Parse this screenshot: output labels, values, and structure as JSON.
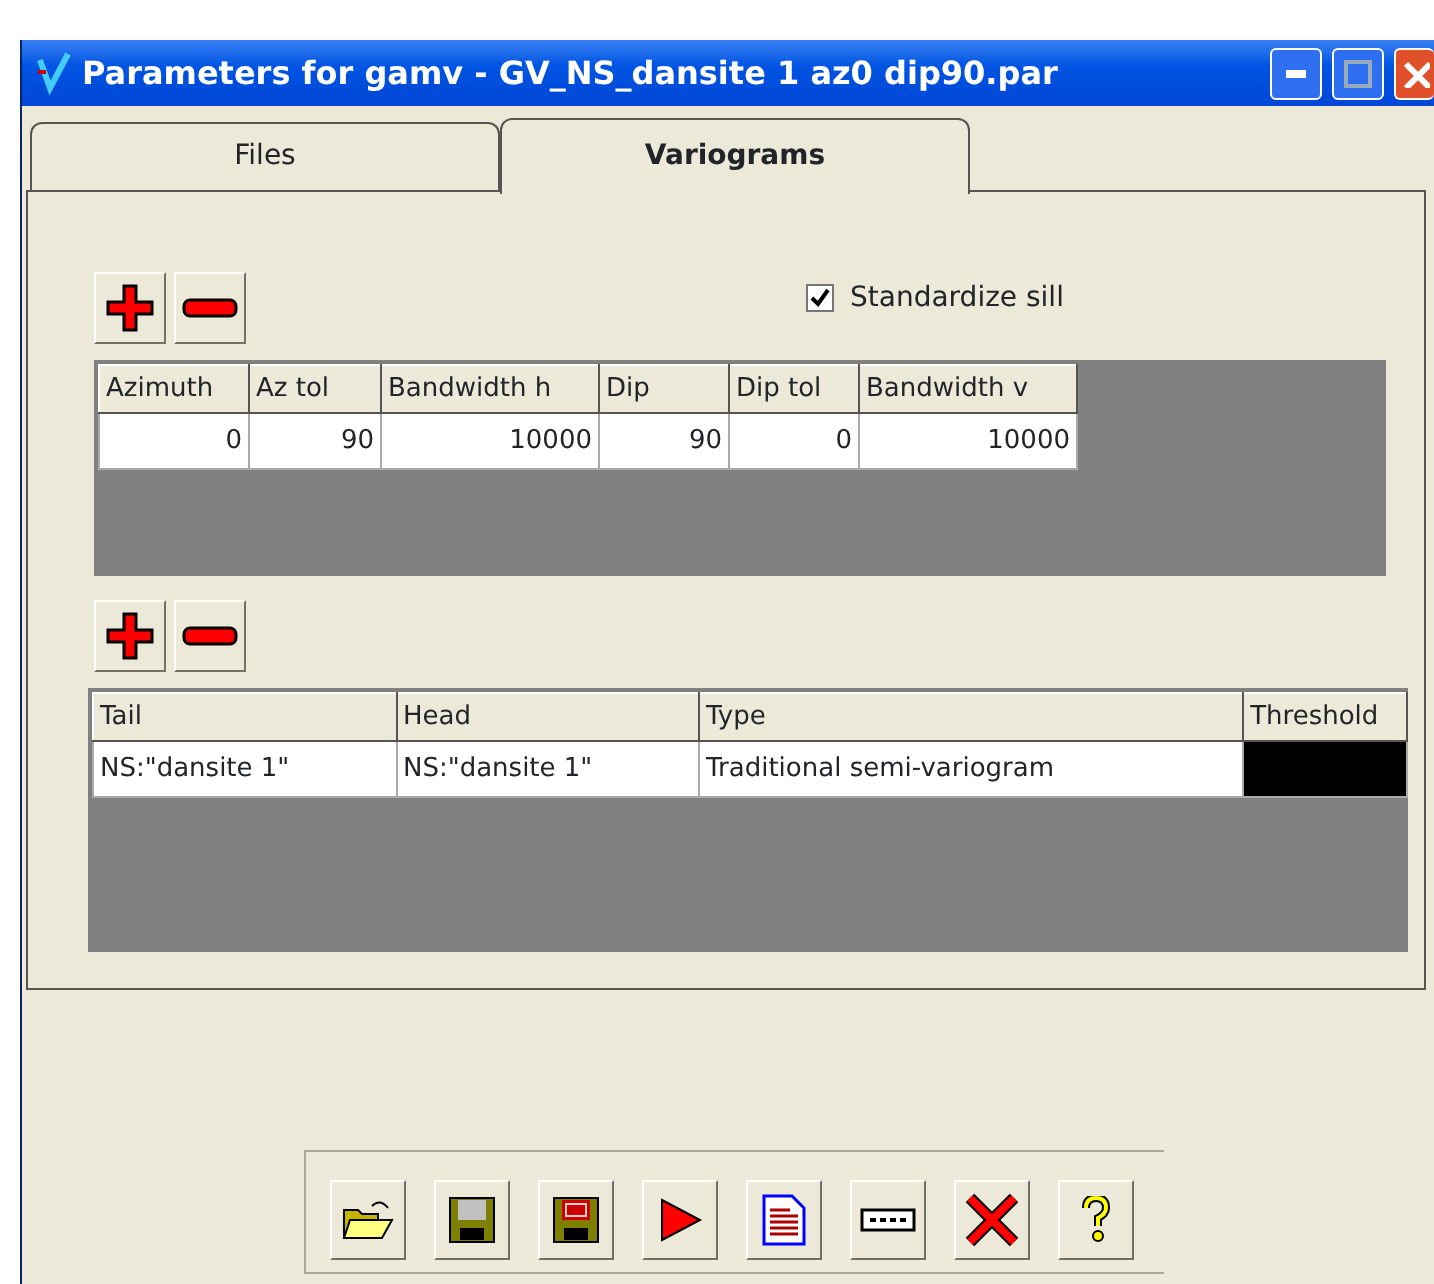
{
  "window": {
    "title": "Parameters for gamv - GV_NS_dansite 1 az0 dip90.par"
  },
  "tabs": [
    {
      "label": "Files",
      "selected": false
    },
    {
      "label": "Variograms",
      "selected": true
    }
  ],
  "directions": {
    "standardize_sill": {
      "label": "Standardize sill",
      "checked": true
    },
    "columns": [
      "Azimuth",
      "Az tol",
      "Bandwidth h",
      "Dip",
      "Dip tol",
      "Bandwidth v"
    ],
    "rows": [
      [
        "0",
        "90",
        "10000",
        "90",
        "0",
        "10000"
      ]
    ]
  },
  "variograms": {
    "columns": [
      "Tail",
      "Head",
      "Type",
      "Threshold"
    ],
    "rows": [
      [
        {
          "text": "NS:\"dansite 1\"",
          "selected": false
        },
        {
          "text": "NS:\"dansite 1\"",
          "selected": false
        },
        {
          "text": "Traditional semi-variogram",
          "selected": false
        },
        {
          "selected": true
        }
      ]
    ]
  },
  "toolbar": [
    {
      "kind": "open"
    },
    {
      "kind": "save"
    },
    {
      "kind": "saveas"
    },
    {
      "kind": "run"
    },
    {
      "kind": "report"
    },
    {
      "kind": "keyboard"
    },
    {
      "kind": "close"
    },
    {
      "kind": "help"
    }
  ]
}
